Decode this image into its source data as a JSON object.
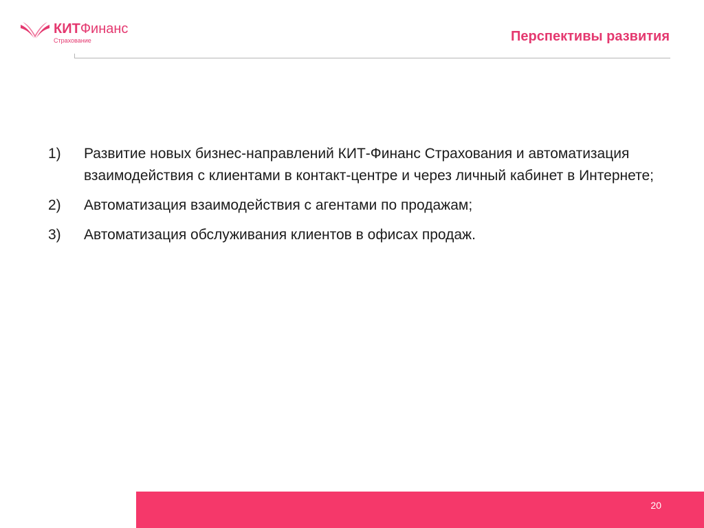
{
  "logo": {
    "brand_bold": "КИТ",
    "brand_regular": "Финанс",
    "subtitle": "Страхование",
    "icon": "bird-wings-icon",
    "color": "#e4386f"
  },
  "header": {
    "title": "Перспективы развития",
    "color": "#e4386f"
  },
  "content": {
    "items": [
      {
        "number": "1)",
        "text": "Развитие новых бизнес-направлений КИТ-Финанс Страхования и автоматизация взаимодействия с клиентами в контакт-центре и через личный кабинет в Интернете;"
      },
      {
        "number": "2)",
        "text": "Автоматизация взаимодействия с агентами по продажам;"
      },
      {
        "number": "3)",
        "text": "Автоматизация обслуживания клиентов в офисах продаж."
      }
    ]
  },
  "footer": {
    "page_number": "20",
    "bar_color": "#f5386a"
  }
}
